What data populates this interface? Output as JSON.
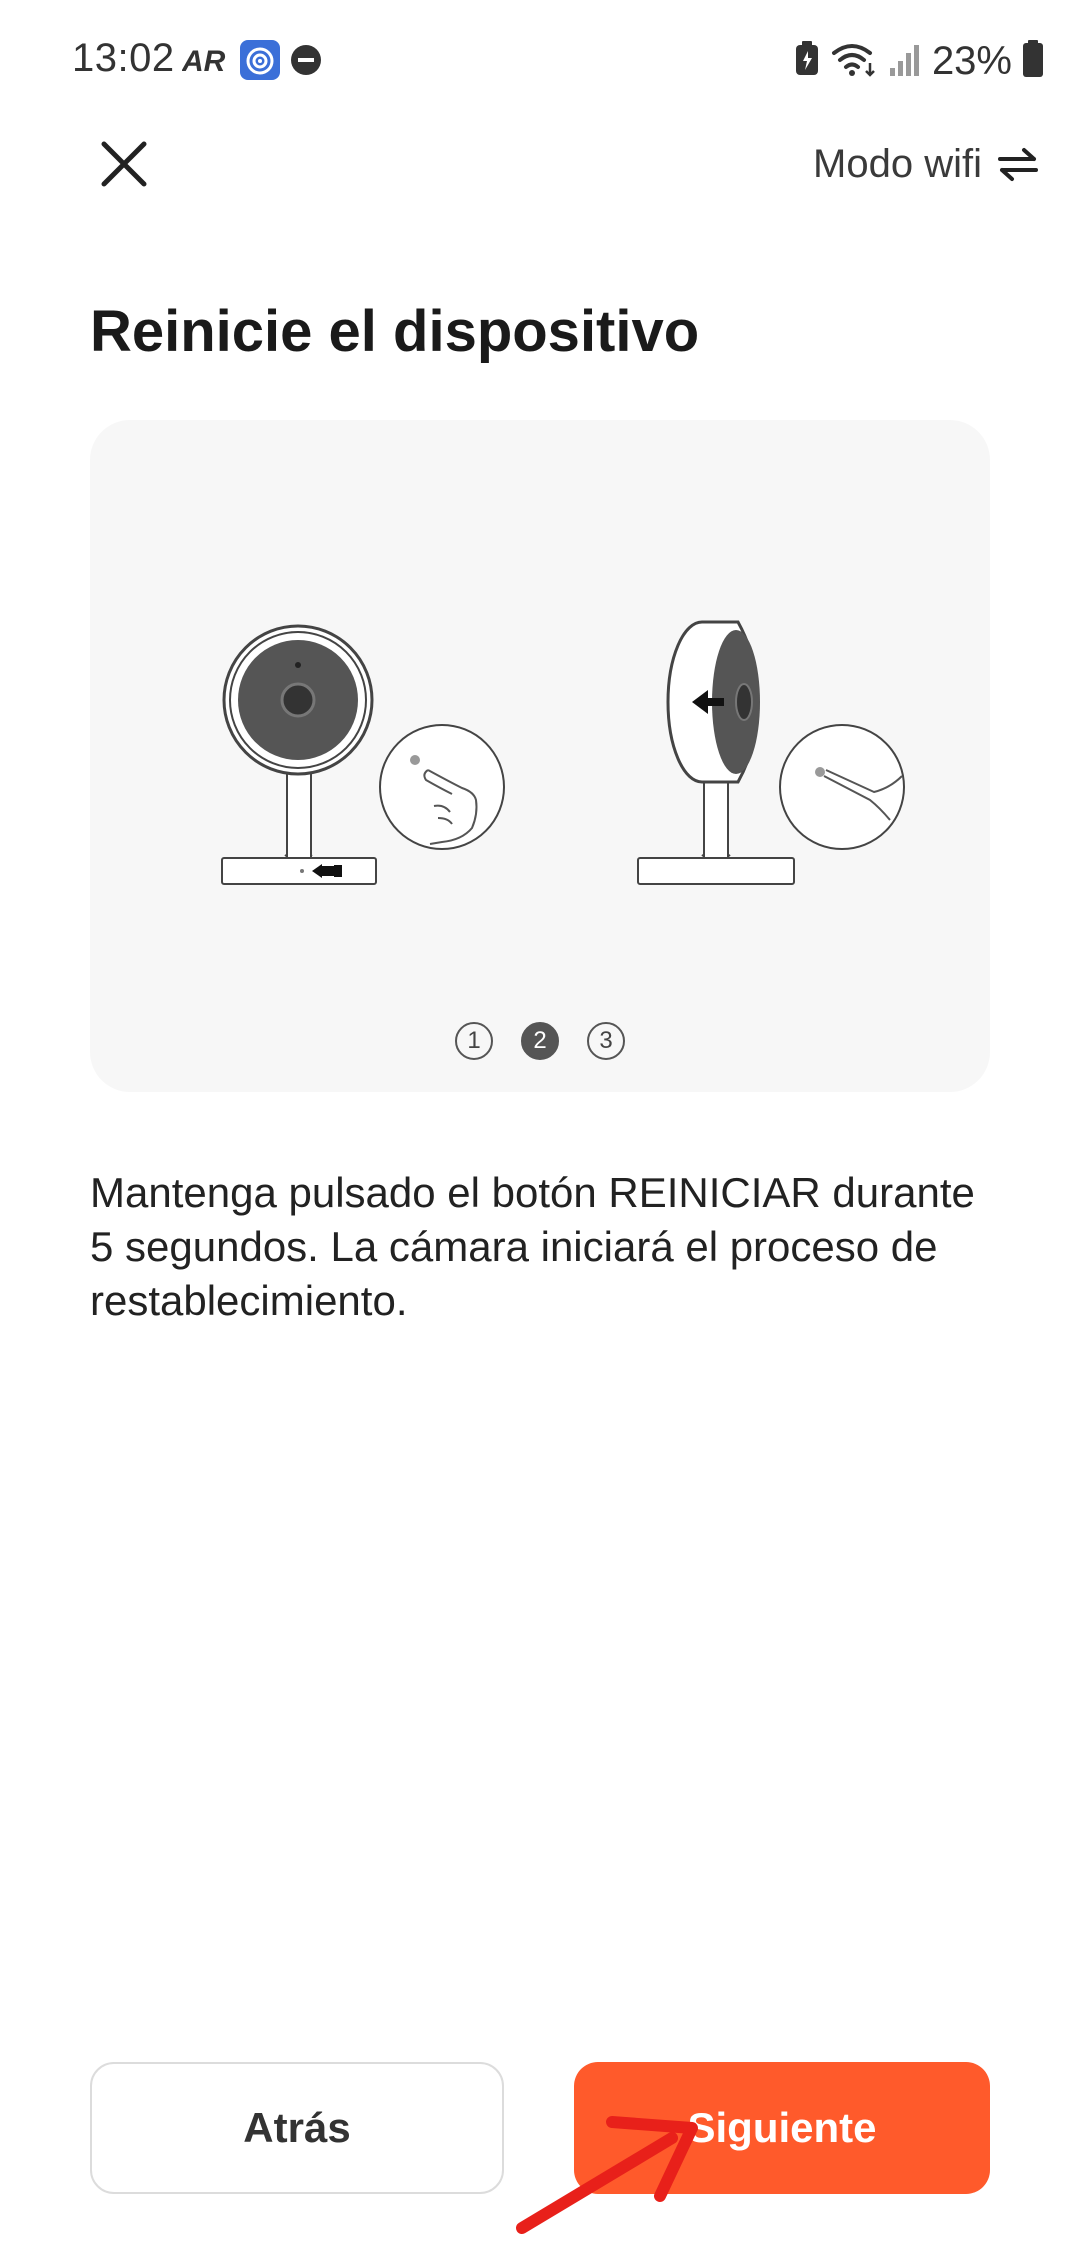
{
  "status_bar": {
    "time": "13:02",
    "battery_percent": "23%",
    "icons_left": [
      "ar-zone-icon",
      "app-target-icon",
      "do-not-disturb-icon"
    ],
    "icons_right": [
      "battery-saver-icon",
      "wifi-icon",
      "signal-icon",
      "battery-icon"
    ]
  },
  "header": {
    "close_icon": "close-icon",
    "mode_label": "Modo wifi",
    "mode_icon": "swap-arrows-icon"
  },
  "title": "Reinicie el dispositivo",
  "steps": {
    "items": [
      "1",
      "2",
      "3"
    ],
    "active_index": 1
  },
  "description": "Mantenga pulsado el botón REINICIAR durante 5 segundos. La cámara iniciará el proceso de restablecimiento.",
  "buttons": {
    "back_label": "Atrás",
    "next_label": "Siguiente"
  },
  "colors": {
    "accent": "#ff5a2b",
    "annotation_arrow": "#e8201a",
    "card_background": "#f7f7f7"
  }
}
